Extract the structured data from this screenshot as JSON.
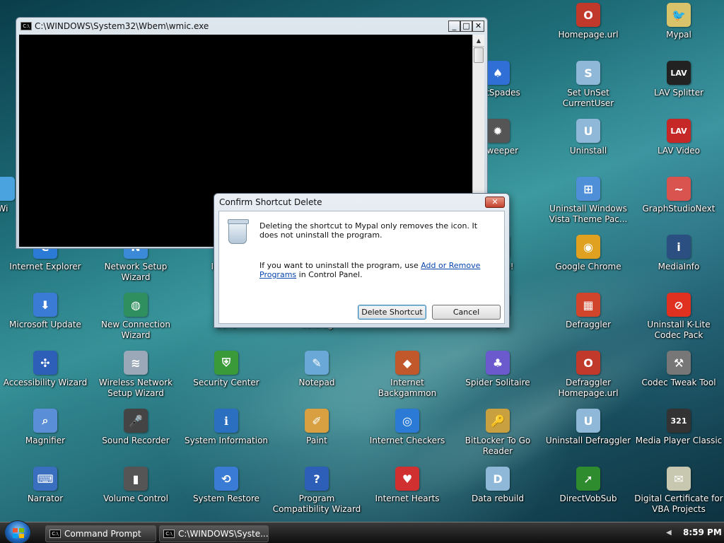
{
  "desktop_icons": [
    {
      "label": "Homepage.url",
      "color": "#c0392b",
      "glyph": "O"
    },
    {
      "label": "Mypal",
      "color": "#d9c36a",
      "glyph": "🐦"
    },
    {
      "label": "netSpades",
      "color": "#2f6fd6",
      "glyph": "♠"
    },
    {
      "label": "Set UnSet CurrentUser",
      "color": "#8fb8d8",
      "glyph": "S"
    },
    {
      "label": "LAV Splitter",
      "color": "#222222",
      "glyph": "LAV"
    },
    {
      "label": "esweeper",
      "color": "#555555",
      "glyph": "✹"
    },
    {
      "label": "Uninstall",
      "color": "#8fb8d8",
      "glyph": "U"
    },
    {
      "label": "LAV Video",
      "color": "#c62828",
      "glyph": "LAV"
    },
    {
      "label": "Uninstall Windows Vista Theme Pac...",
      "color": "#4f8fd8",
      "glyph": "⊞"
    },
    {
      "label": "GraphStudioNext",
      "color": "#d9534f",
      "glyph": "~"
    },
    {
      "label": "Wi",
      "color": "#4aa3df",
      "glyph": ""
    },
    {
      "label": "Internet Explorer",
      "color": "#2b7bd6",
      "glyph": "e"
    },
    {
      "label": "Network Setup Wizard",
      "color": "#3a8ad8",
      "glyph": "N"
    },
    {
      "label": "Interne",
      "color": "#3a8ad8",
      "glyph": ""
    },
    {
      "label": "re Plus!",
      "color": "#6aa84f",
      "glyph": ""
    },
    {
      "label": "Google Chrome",
      "color": "#e0a020",
      "glyph": "◉"
    },
    {
      "label": "MediaInfo",
      "color": "#2a4f80",
      "glyph": "i"
    },
    {
      "label": "Microsoft Update",
      "color": "#3a7bd5",
      "glyph": "⬇"
    },
    {
      "label": "New Connection Wizard",
      "color": "#2f8f5f",
      "glyph": "◍"
    },
    {
      "label": "Sche",
      "color": "#5577aa",
      "glyph": ""
    },
    {
      "label": "Catalog",
      "color": "#8fb8d8",
      "glyph": ""
    },
    {
      "label": "e",
      "color": "#8fb8d8",
      "glyph": ""
    },
    {
      "label": "Defraggler",
      "color": "#d0452b",
      "glyph": "▦"
    },
    {
      "label": "Uninstall K-Lite Codec Pack",
      "color": "#e03020",
      "glyph": "⊘"
    },
    {
      "label": "Accessibility Wizard",
      "color": "#2d5fb8",
      "glyph": "✣"
    },
    {
      "label": "Wireless Network Setup Wizard",
      "color": "#9aa8b8",
      "glyph": "≋"
    },
    {
      "label": "Security Center",
      "color": "#3a9a3a",
      "glyph": "⛨"
    },
    {
      "label": "Notepad",
      "color": "#6aa8d8",
      "glyph": "✎"
    },
    {
      "label": "Internet Backgammon",
      "color": "#c0582b",
      "glyph": "◆"
    },
    {
      "label": "Spider Solitaire",
      "color": "#6a5acd",
      "glyph": "♣"
    },
    {
      "label": "Defraggler Homepage.url",
      "color": "#c0392b",
      "glyph": "O"
    },
    {
      "label": "Codec Tweak Tool",
      "color": "#777777",
      "glyph": "⚒"
    },
    {
      "label": "Magnifier",
      "color": "#5a8fd8",
      "glyph": "⌕"
    },
    {
      "label": "Sound Recorder",
      "color": "#444444",
      "glyph": "🎤"
    },
    {
      "label": "System Information",
      "color": "#2b6fc0",
      "glyph": "ℹ"
    },
    {
      "label": "Paint",
      "color": "#d8a040",
      "glyph": "✐"
    },
    {
      "label": "Internet Checkers",
      "color": "#2b7bd6",
      "glyph": "◎"
    },
    {
      "label": "BitLocker To Go Reader",
      "color": "#c8a040",
      "glyph": "🔑"
    },
    {
      "label": "Uninstall Defraggler",
      "color": "#8fb8d8",
      "glyph": "U"
    },
    {
      "label": "Media Player Classic",
      "color": "#333333",
      "glyph": "321"
    },
    {
      "label": "Narrator",
      "color": "#3a6fc0",
      "glyph": "⌨"
    },
    {
      "label": "Volume Control",
      "color": "#555555",
      "glyph": "▮"
    },
    {
      "label": "System Restore",
      "color": "#3a7bd5",
      "glyph": "⟲"
    },
    {
      "label": "Program Compatibility Wizard",
      "color": "#2d5fb8",
      "glyph": "?"
    },
    {
      "label": "Internet Hearts",
      "color": "#d03030",
      "glyph": "♥"
    },
    {
      "label": "Data rebuild",
      "color": "#8fb8d8",
      "glyph": "D"
    },
    {
      "label": "DirectVobSub",
      "color": "#2e8b2e",
      "glyph": "➚"
    },
    {
      "label": "Digital Certificate for VBA Projects",
      "color": "#c8c8b0",
      "glyph": "✉"
    }
  ],
  "console_window": {
    "title": "C:\\WINDOWS\\System32\\Wbem\\wmic.exe",
    "icon_text": "C:\\",
    "minimize": "_",
    "maximize": "□",
    "close": "✕"
  },
  "dialog": {
    "title": "Confirm Shortcut Delete",
    "close": "✕",
    "message1": "Deleting the shortcut to Mypal only removes the icon. It does not uninstall the program.",
    "message2_prefix": "If you want to uninstall the program, use ",
    "message2_link": "Add or Remove Programs",
    "message2_suffix": " in Control Panel.",
    "delete_button": "Delete Shortcut",
    "cancel_button": "Cancel"
  },
  "taskbar": {
    "tasks": [
      {
        "label": "Command Prompt"
      },
      {
        "label": "C:\\WINDOWS\\Syste..."
      }
    ],
    "task_icon_text": "C:\\",
    "tray_arrow": "◀",
    "clock": "8:59 PM"
  }
}
